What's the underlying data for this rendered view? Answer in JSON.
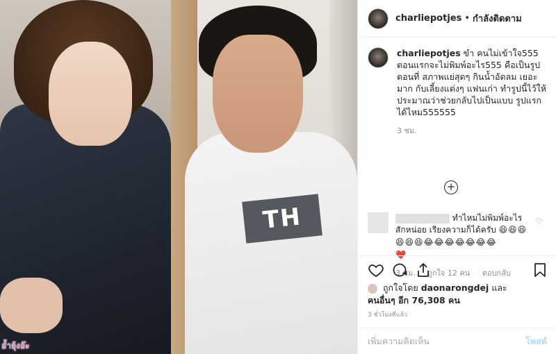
{
  "post": {
    "username": "charliepotjes",
    "separator": "•",
    "follow_status": "กำลังติดตาม",
    "caption": {
      "username": "charliepotjes",
      "text": "ขำ คนไม่เข้าใจ555 ตอนแรกจะไม่พิมพ์อะไร555 คือเป็นรูปตอนที่ สภาพแย่สุดๆ กินน้ำอัดลม เยอะมาก กับเลี้ยงแต่งๆ แฟนเก่า ทำรูปนี้ไว้ให้ ประมาณว่าช่วยกลับไปเป็นแบบ รูปแรกได้ไหม555555",
      "time": "3 ชม."
    },
    "load_more_icon": "plus-circle-icon",
    "comment": {
      "text": "ทำไหมไม่พิมพ์อะไรสักหน่อย เรียงความก็ได้ครับ",
      "emojis_line1": "😆😆😆",
      "emojis_line2": "😆😆😆😂😂😂😂😂😂😂",
      "heart": "❤️",
      "time": "3 ชม.",
      "likes": "ถูกใจ 12 คน",
      "reply": "ตอบกลับ",
      "like_icon": "heart-outline-icon"
    },
    "actions": {
      "like_icon": "heart-icon",
      "comment_icon": "comment-icon",
      "share_icon": "share-icon",
      "save_icon": "bookmark-icon"
    },
    "likes": {
      "prefix": "ถูกใจโดย",
      "user": "daonarongdej",
      "and": "และ",
      "others": "คนอื่นๆ อีก 76,308 คน"
    },
    "timestamp": "3 ชั่วโมงที่แล้ว",
    "add_comment": {
      "placeholder": "เพิ่มความคิดเห็น",
      "post_label": "โพสต์"
    },
    "image": {
      "watermark": "อ้ำยุ้งอ๊ะ",
      "shirt_print": "TH"
    }
  }
}
